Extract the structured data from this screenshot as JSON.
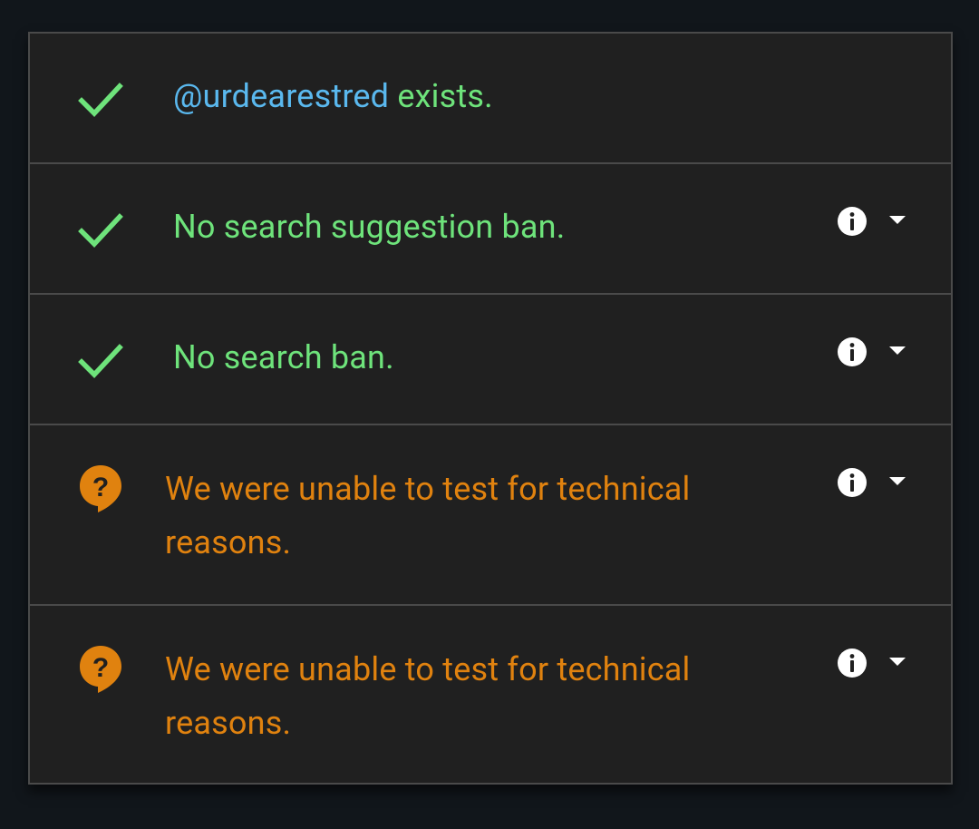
{
  "colors": {
    "background": "#11161b",
    "panel": "#202020",
    "border": "#4a4a4a",
    "success": "#6ee37b",
    "warning": "#e0820f",
    "handle": "#5ab8ee"
  },
  "rows": [
    {
      "status": "success",
      "icon": "check-icon",
      "handle": "@urdearestred",
      "text": " exists."
    },
    {
      "status": "success",
      "icon": "check-icon",
      "text": "No search suggestion ban.",
      "actions": [
        "info-icon",
        "dropdown-arrow-icon"
      ]
    },
    {
      "status": "success",
      "icon": "check-icon",
      "text": "No search ban.",
      "actions": [
        "info-icon",
        "dropdown-arrow-icon"
      ]
    },
    {
      "status": "warning",
      "icon": "question-bubble-icon",
      "text": "We were unable to test for technical reasons.",
      "actions": [
        "info-icon",
        "dropdown-arrow-icon"
      ]
    },
    {
      "status": "warning",
      "icon": "question-bubble-icon",
      "text": "We were unable to test for technical reasons.",
      "actions": [
        "info-icon",
        "dropdown-arrow-icon"
      ]
    }
  ]
}
